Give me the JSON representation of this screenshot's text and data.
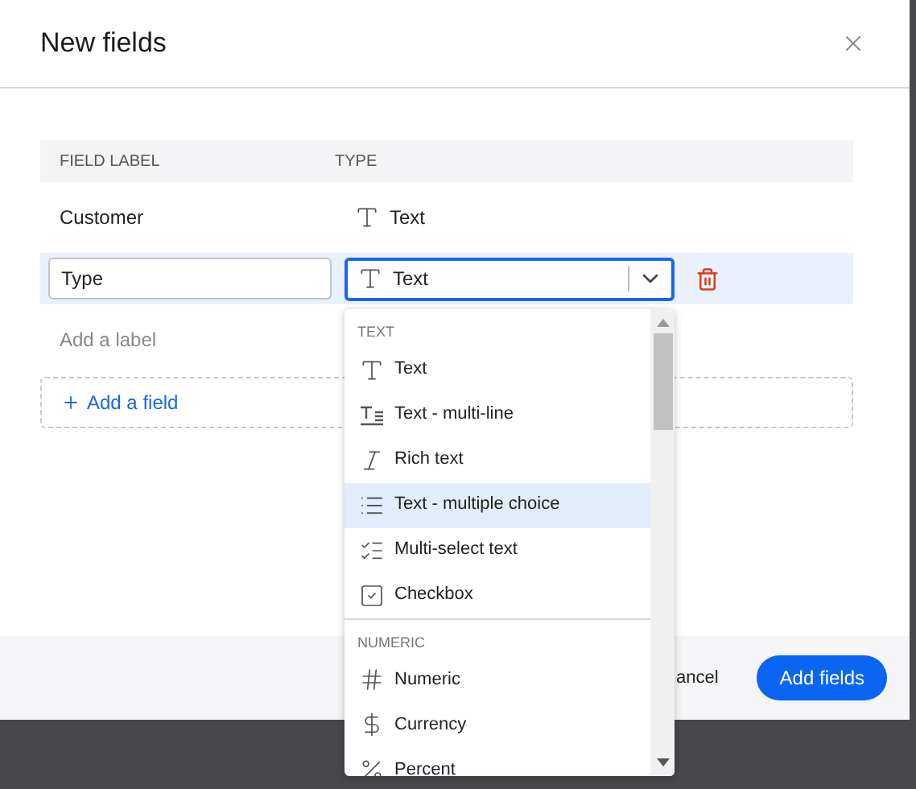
{
  "dialog": {
    "title": "New fields",
    "table": {
      "columns": [
        "FIELD LABEL",
        "TYPE"
      ],
      "rows": [
        {
          "kind": "static",
          "label": "Customer",
          "type": {
            "kind": "text",
            "label": "Text"
          }
        },
        {
          "kind": "editing",
          "label": "Type",
          "type": {
            "kind": "text",
            "label": "Text"
          }
        },
        {
          "kind": "new",
          "placeholder": "Add a label"
        }
      ]
    },
    "add_field": "Add a field",
    "buttons": [
      {
        "kind": "secondary",
        "label": "ancel"
      },
      {
        "kind": "primary",
        "label": "Add fields"
      }
    ]
  },
  "dropdown": {
    "groups": [
      {
        "heading": "TEXT",
        "items": [
          {
            "kind": "text",
            "label": "Text",
            "selected": false
          },
          {
            "kind": "multiline",
            "label": "Text - multi-line",
            "selected": false
          },
          {
            "kind": "rich",
            "label": "Rich text",
            "selected": false
          },
          {
            "kind": "list",
            "label": "Text - multiple choice",
            "selected": true
          },
          {
            "kind": "multiselect",
            "label": "Multi-select text",
            "selected": false
          },
          {
            "kind": "checkbox",
            "label": "Checkbox",
            "selected": false
          }
        ]
      },
      {
        "heading": "NUMERIC",
        "items": [
          {
            "kind": "hash",
            "label": "Numeric",
            "selected": false
          },
          {
            "kind": "dollar",
            "label": "Currency",
            "selected": false
          },
          {
            "kind": "percent",
            "label": "Percent",
            "selected": false
          }
        ]
      }
    ]
  }
}
